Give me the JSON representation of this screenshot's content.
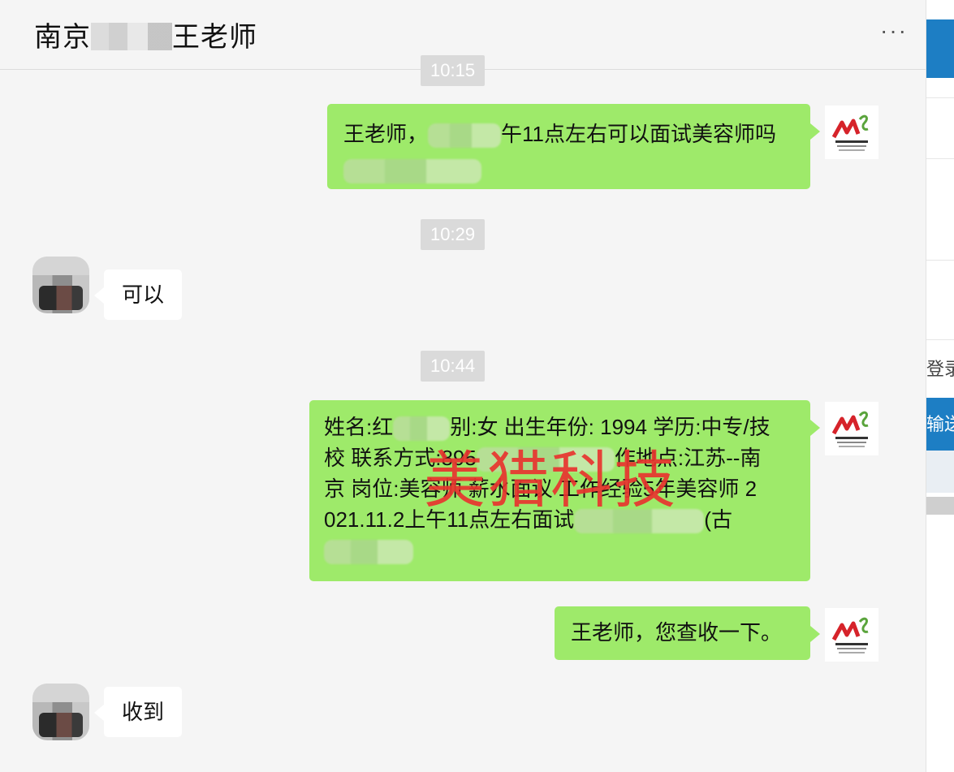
{
  "header": {
    "title_prefix": "南京",
    "title_suffix": "王老师",
    "more_label": "···"
  },
  "messages": [
    {
      "type": "time",
      "text": "10:15"
    },
    {
      "type": "me",
      "text_start": "王老师，",
      "text_end": "午11点左右可以面试美容师吗"
    },
    {
      "type": "time",
      "text": "10:29"
    },
    {
      "type": "them",
      "text": "可以"
    },
    {
      "type": "time",
      "text": "10:44"
    },
    {
      "type": "me",
      "lines": [
        "姓名:红",
        "别:女 出生年份: 1994 学历:中专/技",
        "校 联系方式:",
        "895",
        "作地点:江苏--南",
        "京 岗位:美容师 薪水面议 工作经验5年美容师 2",
        "021.11.2上午11点左右面试",
        "(古"
      ]
    },
    {
      "type": "me",
      "text": "王老师，您查收一下。"
    },
    {
      "type": "them",
      "text": "收到"
    }
  ],
  "watermark": "美猎科技",
  "side_panel": {
    "label_1": "登录",
    "label_2": "输送"
  },
  "colors": {
    "my_bubble": "#9eea6a",
    "their_bubble": "#ffffff",
    "watermark": "#e8342f",
    "accent_blue": "#1d7ec4"
  }
}
